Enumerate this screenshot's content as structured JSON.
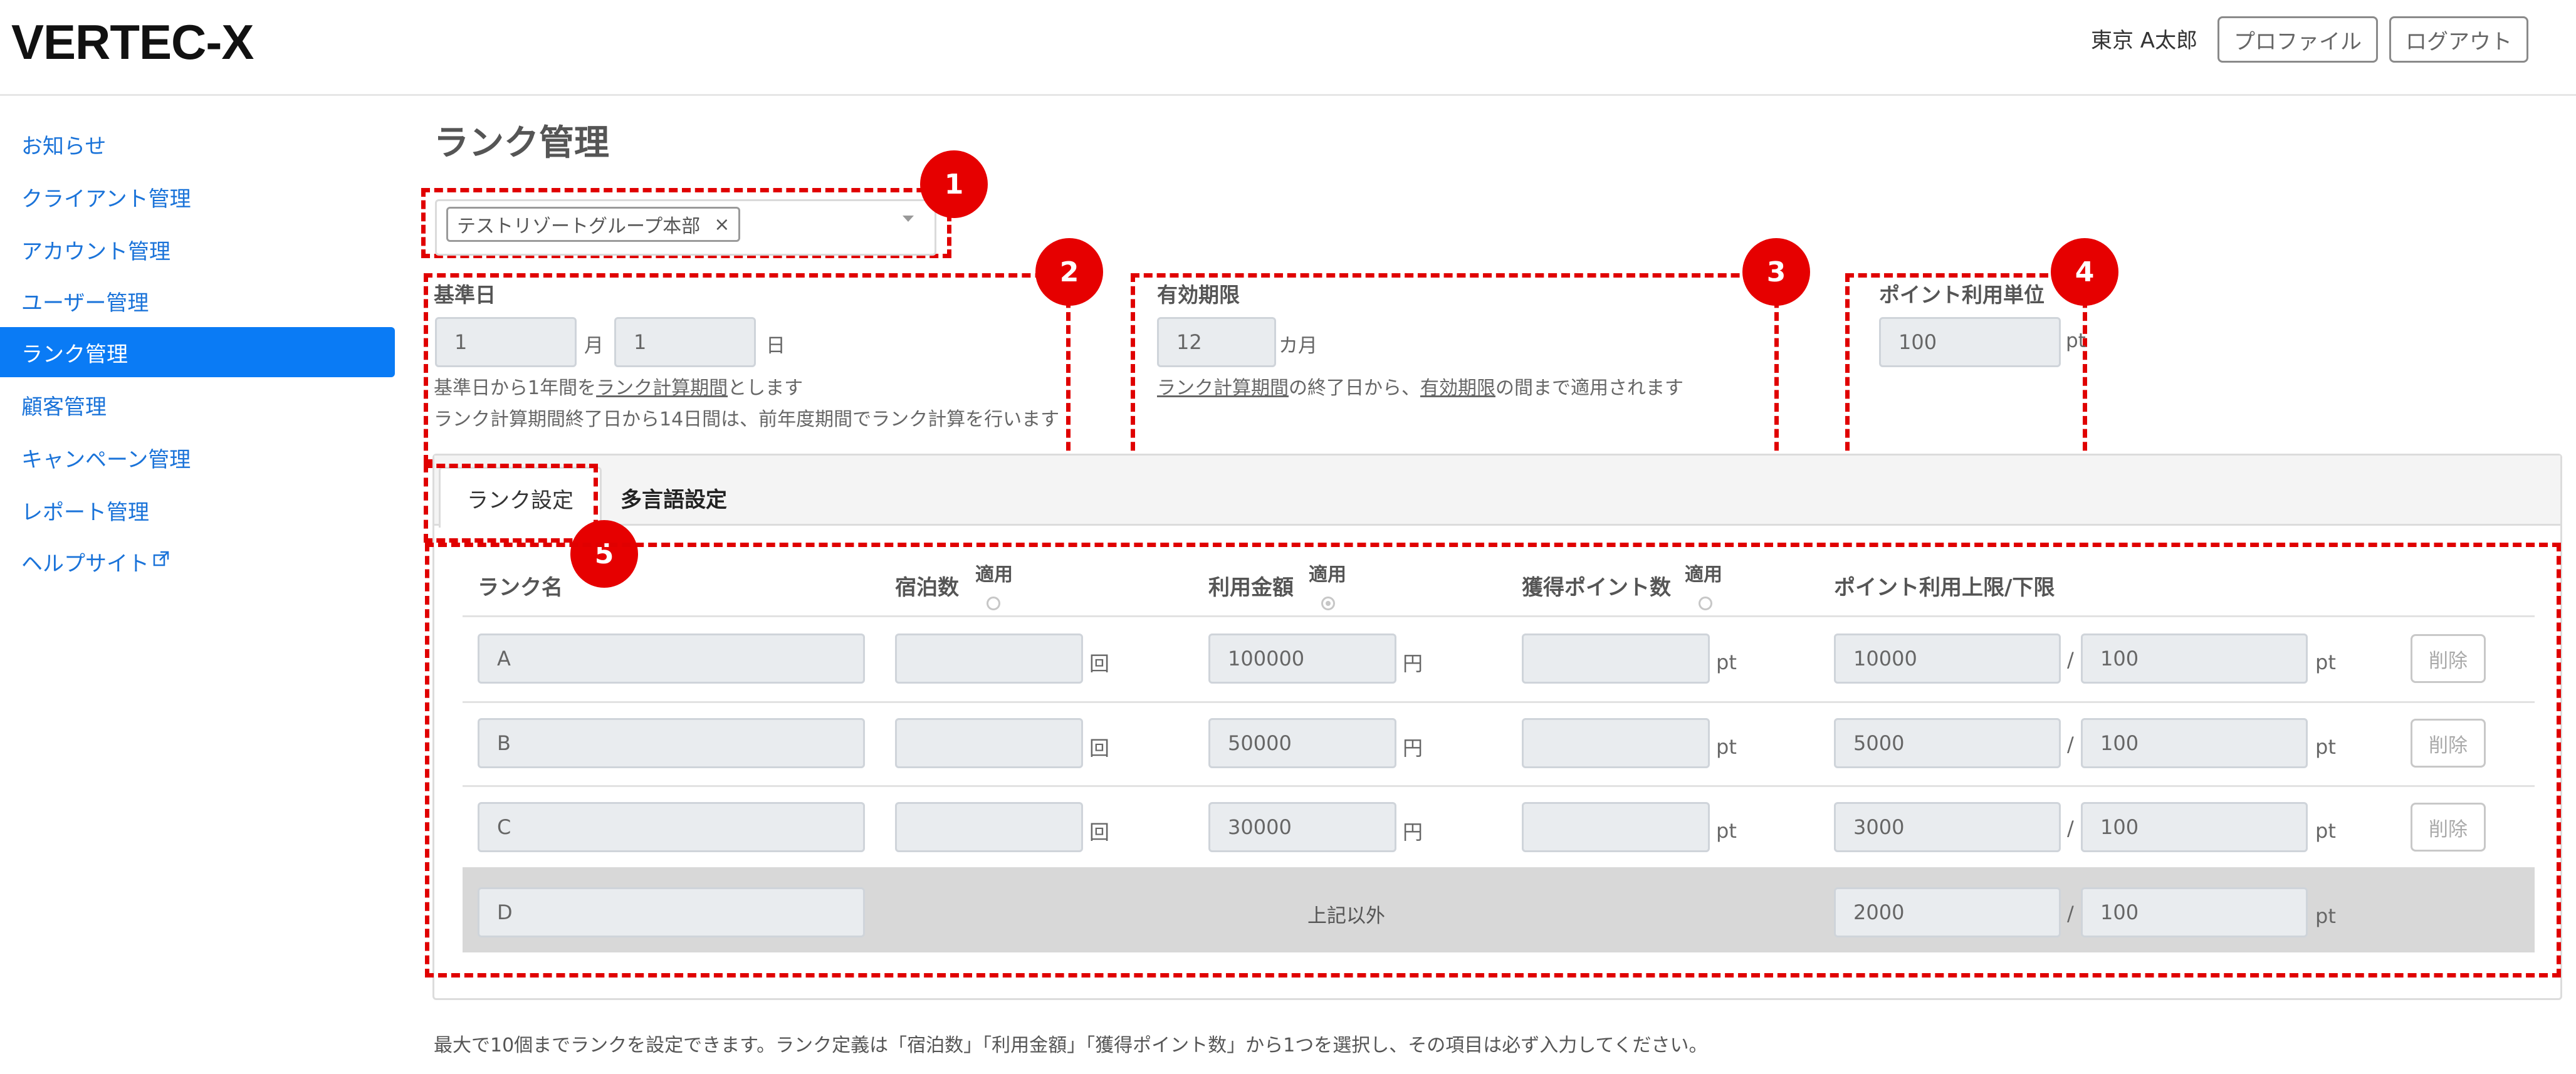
{
  "header": {
    "logo": "VERTEC-X",
    "user_name": "東京 A太郎",
    "profile_button": "プロファイル",
    "logout_button": "ログアウト"
  },
  "sidebar": {
    "items": [
      {
        "label": "お知らせ",
        "active": false
      },
      {
        "label": "クライアント管理",
        "active": false
      },
      {
        "label": "アカウント管理",
        "active": false
      },
      {
        "label": "ユーザー管理",
        "active": false
      },
      {
        "label": "ランク管理",
        "active": true
      },
      {
        "label": "顧客管理",
        "active": false
      },
      {
        "label": "キャンペーン管理",
        "active": false
      },
      {
        "label": "レポート管理",
        "active": false
      },
      {
        "label": "ヘルプサイト",
        "active": false
      }
    ]
  },
  "page_title": "ランク管理",
  "group_select": {
    "selected": "テストリゾートグループ本部",
    "remove": "×"
  },
  "badges": [
    "1",
    "2",
    "3",
    "4",
    "5"
  ],
  "base_date": {
    "label": "基準日",
    "month_value": "1",
    "month_unit": "月",
    "day_value": "1",
    "day_unit": "日",
    "note1_pre": "基準日から1年間を",
    "note1_link": "ランク計算期間",
    "note1_post": "とします",
    "note2": "ランク計算期間終了日から14日間は、前年度期間でランク計算を行います"
  },
  "expiry": {
    "label": "有効期限",
    "value": "12",
    "unit": "カ月",
    "note_link1": "ランク計算期間",
    "note_mid": "の終了日から、",
    "note_link2": "有効期限",
    "note_post": "の間まで適用されます"
  },
  "point_unit": {
    "label": "ポイント利用単位",
    "value": "100",
    "unit": "pt"
  },
  "tabs": [
    {
      "label": "ランク設定",
      "active": true
    },
    {
      "label": "多言語設定",
      "active": false
    }
  ],
  "table": {
    "headers": {
      "rank_name": "ランク名",
      "stays": "宿泊数",
      "amount": "利用金額",
      "points": "獲得ポイント数",
      "limit": "ポイント利用上限/下限",
      "apply": "適用"
    },
    "units": {
      "stays": "回",
      "amount": "円",
      "points": "pt",
      "limit": "pt",
      "separator": "/"
    },
    "delete_label": "削除",
    "rows": [
      {
        "name": "A",
        "stays": "",
        "amount": "100000",
        "points": "",
        "upper": "10000",
        "lower": "100"
      },
      {
        "name": "B",
        "stays": "",
        "amount": "50000",
        "points": "",
        "upper": "5000",
        "lower": "100"
      },
      {
        "name": "C",
        "stays": "",
        "amount": "30000",
        "points": "",
        "upper": "3000",
        "lower": "100"
      }
    ],
    "last_row": {
      "name": "D",
      "other_label": "上記以外",
      "upper": "2000",
      "lower": "100"
    }
  },
  "footer_note": "最大で10個までランクを設定できます。ランク定義は「宿泊数」「利用金額」「獲得ポイント数」から1つを選択し、その項目は必ず入力してください。",
  "colors": {
    "accent": "#0a7bf5",
    "annotation": "#e00000"
  }
}
